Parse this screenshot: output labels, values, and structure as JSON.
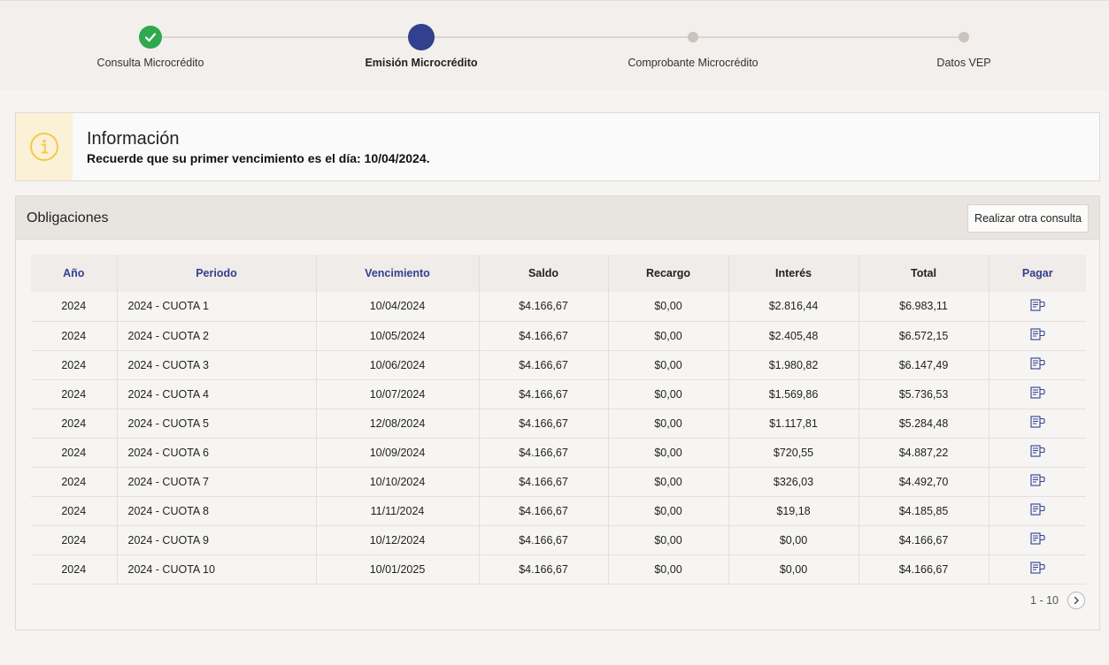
{
  "stepper": {
    "steps": [
      {
        "label": "Consulta Microcrédito",
        "state": "done"
      },
      {
        "label": "Emisión Microcrédito",
        "state": "active"
      },
      {
        "label": "Comprobante Microcrédito",
        "state": "pending"
      },
      {
        "label": "Datos VEP",
        "state": "pending"
      }
    ]
  },
  "info": {
    "title": "Información",
    "message": "Recuerde que su primer vencimiento es el día: 10/04/2024."
  },
  "panel": {
    "title": "Obligaciones",
    "button_label": "Realizar otra consulta"
  },
  "table": {
    "headers": [
      "Año",
      "Periodo",
      "Vencimiento",
      "Saldo",
      "Recargo",
      "Interés",
      "Total",
      "Pagar"
    ],
    "rows": [
      [
        "2024",
        "2024 - CUOTA 1",
        "10/04/2024",
        "$4.166,67",
        "$0,00",
        "$2.816,44",
        "$6.983,11"
      ],
      [
        "2024",
        "2024 - CUOTA 2",
        "10/05/2024",
        "$4.166,67",
        "$0,00",
        "$2.405,48",
        "$6.572,15"
      ],
      [
        "2024",
        "2024 - CUOTA 3",
        "10/06/2024",
        "$4.166,67",
        "$0,00",
        "$1.980,82",
        "$6.147,49"
      ],
      [
        "2024",
        "2024 - CUOTA 4",
        "10/07/2024",
        "$4.166,67",
        "$0,00",
        "$1.569,86",
        "$5.736,53"
      ],
      [
        "2024",
        "2024 - CUOTA 5",
        "12/08/2024",
        "$4.166,67",
        "$0,00",
        "$1.117,81",
        "$5.284,48"
      ],
      [
        "2024",
        "2024 - CUOTA 6",
        "10/09/2024",
        "$4.166,67",
        "$0,00",
        "$720,55",
        "$4.887,22"
      ],
      [
        "2024",
        "2024 - CUOTA 7",
        "10/10/2024",
        "$4.166,67",
        "$0,00",
        "$326,03",
        "$4.492,70"
      ],
      [
        "2024",
        "2024 - CUOTA 8",
        "11/11/2024",
        "$4.166,67",
        "$0,00",
        "$19,18",
        "$4.185,85"
      ],
      [
        "2024",
        "2024 - CUOTA 9",
        "10/12/2024",
        "$4.166,67",
        "$0,00",
        "$0,00",
        "$4.166,67"
      ],
      [
        "2024",
        "2024 - CUOTA 10",
        "10/01/2025",
        "$4.166,67",
        "$0,00",
        "$0,00",
        "$4.166,67"
      ]
    ],
    "pay_icon": "receipt-pay-icon"
  },
  "pager": {
    "range": "1 - 10"
  },
  "colors": {
    "primary": "#333f8f",
    "success": "#2fa84f",
    "warning": "#f3c94f"
  }
}
